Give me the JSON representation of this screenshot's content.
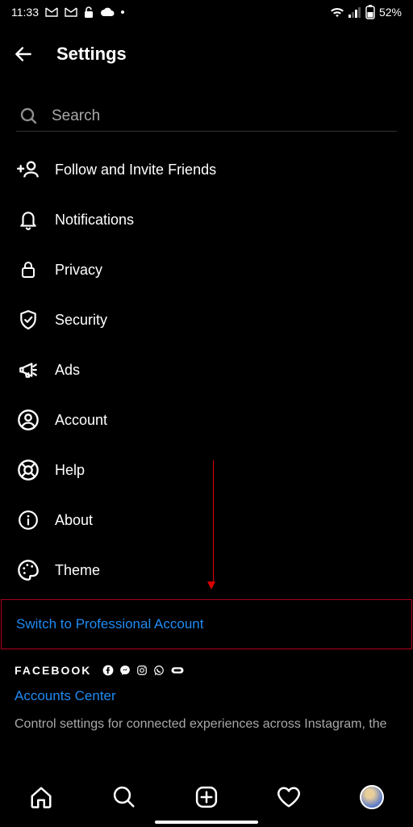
{
  "status": {
    "time": "11:33",
    "battery": "52%"
  },
  "header": {
    "title": "Settings"
  },
  "search": {
    "placeholder": "Search",
    "value": ""
  },
  "menu": {
    "follow": "Follow and Invite Friends",
    "notif": "Notifications",
    "privacy": "Privacy",
    "security": "Security",
    "ads": "Ads",
    "account": "Account",
    "help": "Help",
    "about": "About",
    "theme": "Theme"
  },
  "actions": {
    "switch_pro": "Switch to Professional Account"
  },
  "facebook": {
    "brand": "FACEBOOK",
    "accounts_center": "Accounts Center",
    "description": "Control settings for connected experiences across Instagram, the"
  }
}
